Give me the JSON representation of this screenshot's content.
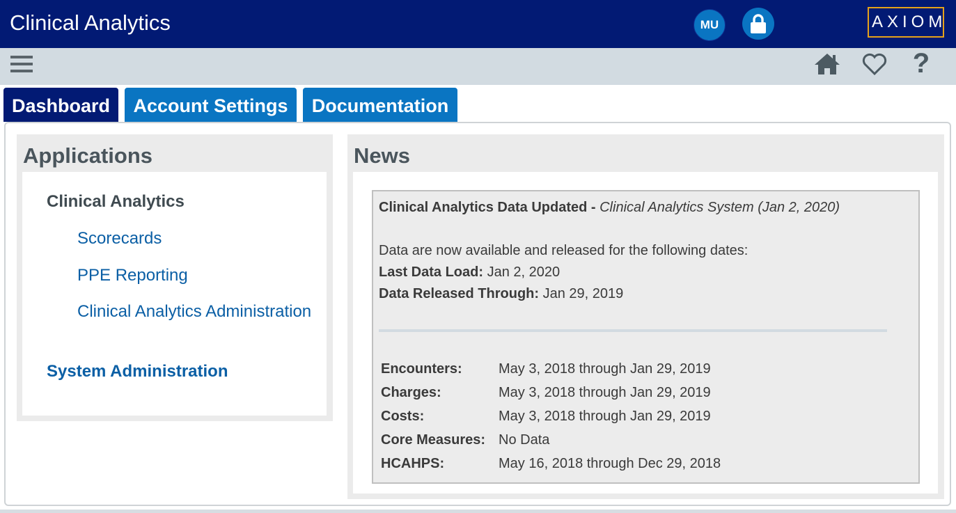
{
  "header": {
    "title": "Clinical Analytics",
    "user_initials": "MU",
    "lock_icon": "lock-icon",
    "logo_text": "AXIOM",
    "colors": {
      "header_bg": "#021a74",
      "accent": "#0a75c2",
      "logo_border": "#e6a21a"
    }
  },
  "toolbar": {
    "menu_icon": "hamburger-menu-icon",
    "home_icon": "home-icon",
    "favorite_icon": "heart-icon",
    "help_glyph": "?"
  },
  "tabs": [
    {
      "label": "Dashboard",
      "active": true
    },
    {
      "label": "Account Settings",
      "active": false
    },
    {
      "label": "Documentation",
      "active": false
    }
  ],
  "applications": {
    "title": "Applications",
    "group_heading": "Clinical Analytics",
    "links": [
      "Scorecards",
      "PPE Reporting",
      "Clinical Analytics Administration"
    ],
    "system_admin": "System Administration"
  },
  "news": {
    "title": "News",
    "headline": "Clinical Analytics Data Updated - ",
    "source": "Clinical Analytics System (Jan 2, 2020)",
    "intro": "Data are now available and released for the following dates:",
    "last_load_label": "Last Data Load:",
    "last_load_value": " Jan 2, 2020",
    "released_label": "Data Released Through:",
    "released_value": " Jan 29, 2019",
    "date_ranges": [
      {
        "label": "Encounters:",
        "value": "May 3, 2018 through Jan 29, 2019"
      },
      {
        "label": "Charges:",
        "value": "May 3, 2018 through Jan 29, 2019"
      },
      {
        "label": "Costs:",
        "value": "May 3, 2018 through Jan 29, 2019"
      },
      {
        "label": "Core Measures:",
        "value": "No Data"
      },
      {
        "label": "HCAHPS:",
        "value": "May 16, 2018 through Dec 29, 2018"
      }
    ]
  }
}
